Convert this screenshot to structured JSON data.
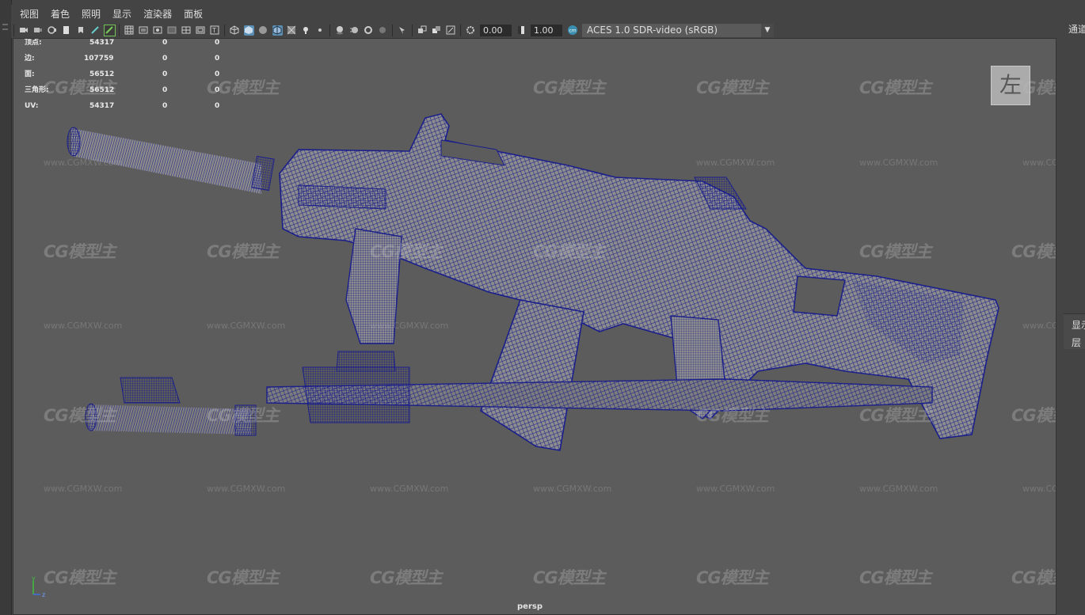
{
  "menubar": {
    "items": [
      "视图",
      "着色",
      "照明",
      "显示",
      "渲染器",
      "面板"
    ]
  },
  "toolbar": {
    "exposure_value": "0.00",
    "gamma_value": "1.00",
    "color_space": "ACES 1.0 SDR-video (sRGB)"
  },
  "hud": {
    "rows": [
      {
        "label": "顶点:",
        "value": "54317",
        "sel": "0",
        "comp": "0"
      },
      {
        "label": "边:",
        "value": "107759",
        "sel": "0",
        "comp": "0"
      },
      {
        "label": "面:",
        "value": "56512",
        "sel": "0",
        "comp": "0"
      },
      {
        "label": "三角形:",
        "value": "56512",
        "sel": "0",
        "comp": "0"
      },
      {
        "label": "UV:",
        "value": "54317",
        "sel": "0",
        "comp": "0"
      }
    ]
  },
  "viewport": {
    "camera": "persp",
    "view_cube_label": "左",
    "axis": {
      "y": "y",
      "z": "z"
    },
    "watermark": "CG模型主",
    "watermark_url": "www.CGMXW.com",
    "wire_color": "#1b1f8a",
    "background_color": "#5c5c5c"
  },
  "right_panel": {
    "channel_box": "通道",
    "display": "显示",
    "layer": "层"
  }
}
